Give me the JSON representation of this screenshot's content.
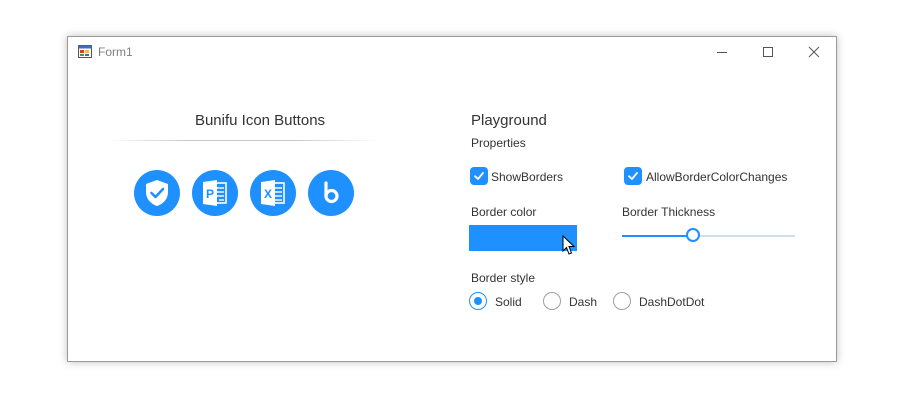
{
  "window": {
    "title": "Form1"
  },
  "left_panel": {
    "title": "Bunifu Icon Buttons",
    "icon_buttons": [
      {
        "icon": "shield-check-icon"
      },
      {
        "icon": "powerpoint-icon",
        "letter": "P"
      },
      {
        "icon": "excel-icon",
        "letter": "X"
      },
      {
        "icon": "bunifu-logo-icon"
      }
    ]
  },
  "playground": {
    "title": "Playground",
    "properties_label": "Properties",
    "show_borders": {
      "label": "ShowBorders",
      "checked": true
    },
    "allow_border_color_changes": {
      "label": "AllowBorderColorChanges",
      "checked": true
    },
    "border_color_label": "Border color",
    "border_color_value": "#1e90ff",
    "border_thickness_label": "Border Thickness",
    "border_thickness_fraction": 0.41,
    "border_style_label": "Border style",
    "border_styles": [
      {
        "label": "Solid",
        "selected": true
      },
      {
        "label": "Dash",
        "selected": false
      },
      {
        "label": "DashDotDot",
        "selected": false
      }
    ]
  },
  "colors": {
    "accent": "#1e90ff",
    "border_gray": "#a0a0a0"
  }
}
